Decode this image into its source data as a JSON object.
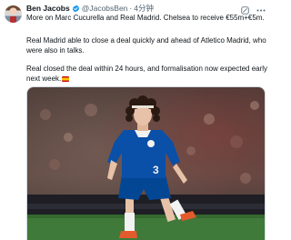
{
  "tweet": {
    "author_name": "Ben Jacobs",
    "handle": "@JacobsBen",
    "separator": "·",
    "time": "4分钟",
    "paragraph1": "More on Marc Cucurella and Real Madrid. Chelsea to receive €55m+€5m.",
    "paragraph2": "Real Madrid able to close a deal quickly and ahead of Atletico Madrid, who were also in talks.",
    "paragraph3": "Real closed the deal within 24 hours, and formalisation now expected early next week.",
    "media": {
      "description_icon": "player-photo",
      "shirt_number": "3"
    }
  },
  "colors": {
    "verified_blue": "#1d9bf0",
    "chelsea_blue": "#034694",
    "text_primary": "#0f1419",
    "text_secondary": "#536471"
  },
  "icons": {
    "verified": "verified-badge-icon",
    "grok": "grok-icon",
    "more": "more-icon",
    "flag": "spain-flag-icon"
  }
}
